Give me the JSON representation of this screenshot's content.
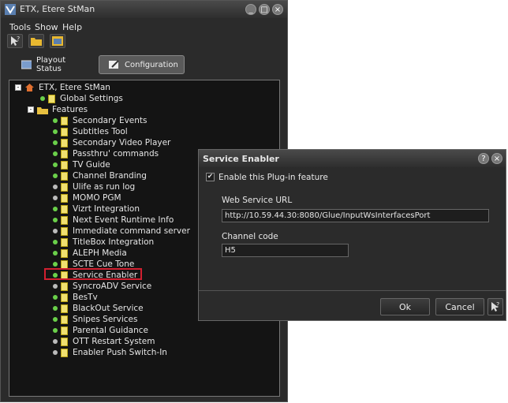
{
  "main_window": {
    "title": "ETX, Etere StMan",
    "controls": {
      "minimize": "_",
      "maximize": "□",
      "close": "×"
    }
  },
  "menu": [
    "Tools",
    "Show",
    "Help"
  ],
  "toolbar": {
    "icons": [
      "help-pointer-icon",
      "folder-icon",
      "window-icon"
    ]
  },
  "tabs": [
    {
      "label": "Playout Status",
      "active": false
    },
    {
      "label": "Configuration",
      "active": true
    }
  ],
  "tree": {
    "root": {
      "label": "ETX, Etere StMan",
      "expander": "-"
    },
    "global_settings": "Global Settings",
    "features_folder": {
      "label": "Features",
      "expander": "-"
    },
    "features": [
      {
        "label": "Secondary Events",
        "enabled": true
      },
      {
        "label": "Subtitles Tool",
        "enabled": true
      },
      {
        "label": "Secondary Video Player",
        "enabled": true
      },
      {
        "label": "Passthru' commands",
        "enabled": true
      },
      {
        "label": "TV Guide",
        "enabled": true
      },
      {
        "label": "Channel Branding",
        "enabled": true
      },
      {
        "label": "Ulife as run log",
        "enabled": false
      },
      {
        "label": "MOMO PGM",
        "enabled": false
      },
      {
        "label": "Vizrt Integration",
        "enabled": true
      },
      {
        "label": "Next Event Runtime Info",
        "enabled": true
      },
      {
        "label": "Immediate command server",
        "enabled": false
      },
      {
        "label": "TitleBox Integration",
        "enabled": true
      },
      {
        "label": "ALEPH Media",
        "enabled": true
      },
      {
        "label": "SCTE Cue Tone",
        "enabled": true
      },
      {
        "label": "Service Enabler",
        "enabled": true,
        "selected": true
      },
      {
        "label": "SyncroADV Service",
        "enabled": false
      },
      {
        "label": "BesTv",
        "enabled": true
      },
      {
        "label": "BlackOut Service",
        "enabled": true
      },
      {
        "label": "Snipes Services",
        "enabled": true
      },
      {
        "label": "Parental Guidance",
        "enabled": true
      },
      {
        "label": "OTT Restart System",
        "enabled": false
      },
      {
        "label": "Enabler Push Switch-In",
        "enabled": false
      }
    ]
  },
  "dialog": {
    "title": "Service Enabler",
    "controls": {
      "help": "?",
      "close": "×"
    },
    "enable_checkbox": {
      "label": "Enable this Plug-in feature",
      "checked": true,
      "mark": "✔"
    },
    "web_service_url": {
      "label": "Web Service URL",
      "value": "http://10.59.44.30:8080/Glue/InputWsInterfacesPort"
    },
    "channel_code": {
      "label": "Channel code",
      "value": "H5"
    },
    "ok_label": "Ok",
    "cancel_label": "Cancel"
  },
  "colors": {
    "enabled_dot": "#6ad04a",
    "disabled_dot": "#bbbbbb",
    "highlight": "#d02030"
  }
}
